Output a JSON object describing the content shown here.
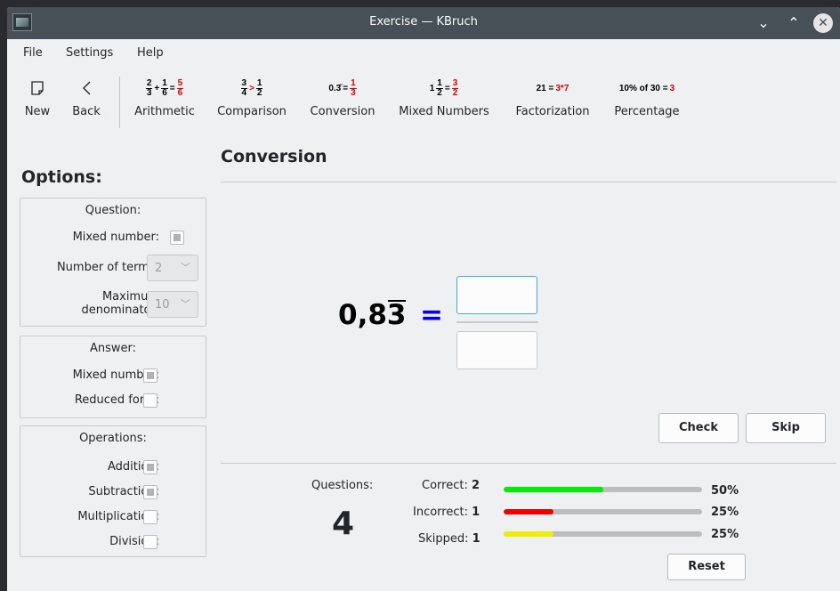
{
  "window": {
    "title": "Exercise — KBruch"
  },
  "menu": [
    "File",
    "Settings",
    "Help"
  ],
  "toolbar": {
    "new": "New",
    "back": "Back",
    "arithmetic": "Arithmetic",
    "comparison": "Comparison",
    "conversion": "Conversion",
    "mixed_numbers": "Mixed Numbers",
    "factorization": "Factorization",
    "percentage": "Percentage",
    "icons": {
      "arithmetic": {
        "a_n": "2",
        "a_d": "3",
        "op": "+",
        "b_n": "1",
        "b_d": "6",
        "eq": "=",
        "r_n": "5",
        "r_d": "6"
      },
      "comparison": {
        "a_n": "3",
        "a_d": "4",
        "op": ">",
        "b_n": "1",
        "b_d": "2"
      },
      "conversion": {
        "dec": "0.3̄",
        "eq": "=",
        "r_n": "1",
        "r_d": "3"
      },
      "mixed": {
        "whole": "1",
        "a_n": "1",
        "a_d": "2",
        "eq": "=",
        "r_n": "3",
        "r_d": "2"
      },
      "factorization": {
        "left": "21 =",
        "right": "3*7"
      },
      "percentage": {
        "left": "10% of 30 =",
        "right": "3"
      }
    }
  },
  "options": {
    "title": "Options:",
    "question": {
      "title": "Question:",
      "mixed_number": "Mixed number:",
      "number_of_terms": "Number of terms:",
      "number_of_terms_value": "2",
      "max_denominator_1": "Maximum",
      "max_denominator_2": "denominator:",
      "max_denominator_value": "10"
    },
    "answer": {
      "title": "Answer:",
      "mixed_number": "Mixed number:",
      "reduced_form": "Reduced form:"
    },
    "operations": {
      "title": "Operations:",
      "addition": "Addition:",
      "subtraction": "Subtraction:",
      "multiplication": "Multiplication:",
      "division": "Division:"
    }
  },
  "exercise": {
    "title": "Conversion",
    "decimal_prefix": "0,8",
    "decimal_repeating": "3",
    "equals": "=",
    "check": "Check",
    "skip": "Skip"
  },
  "stats": {
    "questions_label": "Questions:",
    "questions_value": "4",
    "correct_label": "Correct:",
    "correct_value": "2",
    "correct_pct": "50%",
    "correct_fraction": 0.5,
    "incorrect_label": "Incorrect:",
    "incorrect_value": "1",
    "incorrect_pct": "25%",
    "incorrect_fraction": 0.25,
    "skipped_label": "Skipped:",
    "skipped_value": "1",
    "skipped_pct": "25%",
    "skipped_fraction": 0.25,
    "reset": "Reset",
    "colors": {
      "correct": "#00ee00",
      "incorrect": "#ee0000",
      "skipped": "#eeee00"
    }
  }
}
